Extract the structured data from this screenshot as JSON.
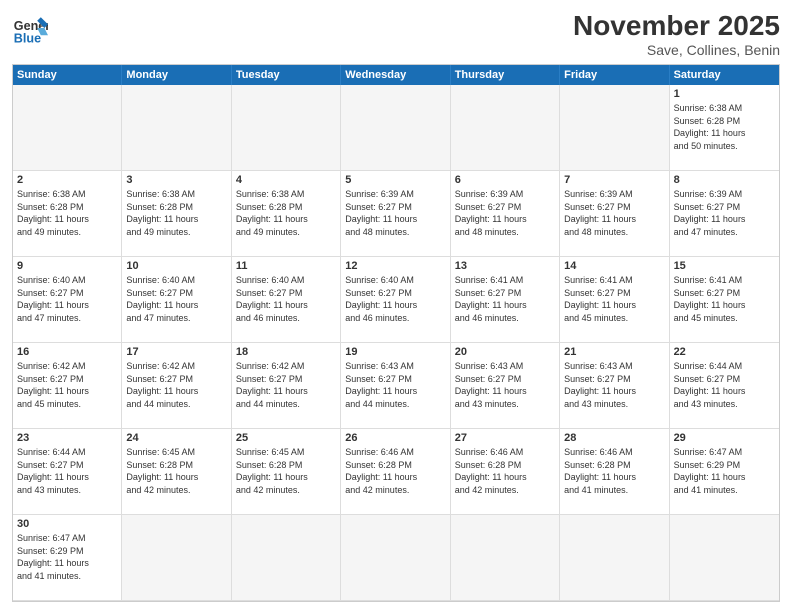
{
  "header": {
    "logo_general": "General",
    "logo_blue": "Blue",
    "month_title": "November 2025",
    "subtitle": "Save, Collines, Benin"
  },
  "weekdays": [
    "Sunday",
    "Monday",
    "Tuesday",
    "Wednesday",
    "Thursday",
    "Friday",
    "Saturday"
  ],
  "weeks": [
    [
      {
        "day": "",
        "text": ""
      },
      {
        "day": "",
        "text": ""
      },
      {
        "day": "",
        "text": ""
      },
      {
        "day": "",
        "text": ""
      },
      {
        "day": "",
        "text": ""
      },
      {
        "day": "",
        "text": ""
      },
      {
        "day": "1",
        "text": "Sunrise: 6:38 AM\nSunset: 6:28 PM\nDaylight: 11 hours\nand 50 minutes."
      }
    ],
    [
      {
        "day": "2",
        "text": "Sunrise: 6:38 AM\nSunset: 6:28 PM\nDaylight: 11 hours\nand 49 minutes."
      },
      {
        "day": "3",
        "text": "Sunrise: 6:38 AM\nSunset: 6:28 PM\nDaylight: 11 hours\nand 49 minutes."
      },
      {
        "day": "4",
        "text": "Sunrise: 6:38 AM\nSunset: 6:28 PM\nDaylight: 11 hours\nand 49 minutes."
      },
      {
        "day": "5",
        "text": "Sunrise: 6:39 AM\nSunset: 6:27 PM\nDaylight: 11 hours\nand 48 minutes."
      },
      {
        "day": "6",
        "text": "Sunrise: 6:39 AM\nSunset: 6:27 PM\nDaylight: 11 hours\nand 48 minutes."
      },
      {
        "day": "7",
        "text": "Sunrise: 6:39 AM\nSunset: 6:27 PM\nDaylight: 11 hours\nand 48 minutes."
      },
      {
        "day": "8",
        "text": "Sunrise: 6:39 AM\nSunset: 6:27 PM\nDaylight: 11 hours\nand 47 minutes."
      }
    ],
    [
      {
        "day": "9",
        "text": "Sunrise: 6:40 AM\nSunset: 6:27 PM\nDaylight: 11 hours\nand 47 minutes."
      },
      {
        "day": "10",
        "text": "Sunrise: 6:40 AM\nSunset: 6:27 PM\nDaylight: 11 hours\nand 47 minutes."
      },
      {
        "day": "11",
        "text": "Sunrise: 6:40 AM\nSunset: 6:27 PM\nDaylight: 11 hours\nand 46 minutes."
      },
      {
        "day": "12",
        "text": "Sunrise: 6:40 AM\nSunset: 6:27 PM\nDaylight: 11 hours\nand 46 minutes."
      },
      {
        "day": "13",
        "text": "Sunrise: 6:41 AM\nSunset: 6:27 PM\nDaylight: 11 hours\nand 46 minutes."
      },
      {
        "day": "14",
        "text": "Sunrise: 6:41 AM\nSunset: 6:27 PM\nDaylight: 11 hours\nand 45 minutes."
      },
      {
        "day": "15",
        "text": "Sunrise: 6:41 AM\nSunset: 6:27 PM\nDaylight: 11 hours\nand 45 minutes."
      }
    ],
    [
      {
        "day": "16",
        "text": "Sunrise: 6:42 AM\nSunset: 6:27 PM\nDaylight: 11 hours\nand 45 minutes."
      },
      {
        "day": "17",
        "text": "Sunrise: 6:42 AM\nSunset: 6:27 PM\nDaylight: 11 hours\nand 44 minutes."
      },
      {
        "day": "18",
        "text": "Sunrise: 6:42 AM\nSunset: 6:27 PM\nDaylight: 11 hours\nand 44 minutes."
      },
      {
        "day": "19",
        "text": "Sunrise: 6:43 AM\nSunset: 6:27 PM\nDaylight: 11 hours\nand 44 minutes."
      },
      {
        "day": "20",
        "text": "Sunrise: 6:43 AM\nSunset: 6:27 PM\nDaylight: 11 hours\nand 43 minutes."
      },
      {
        "day": "21",
        "text": "Sunrise: 6:43 AM\nSunset: 6:27 PM\nDaylight: 11 hours\nand 43 minutes."
      },
      {
        "day": "22",
        "text": "Sunrise: 6:44 AM\nSunset: 6:27 PM\nDaylight: 11 hours\nand 43 minutes."
      }
    ],
    [
      {
        "day": "23",
        "text": "Sunrise: 6:44 AM\nSunset: 6:27 PM\nDaylight: 11 hours\nand 43 minutes."
      },
      {
        "day": "24",
        "text": "Sunrise: 6:45 AM\nSunset: 6:28 PM\nDaylight: 11 hours\nand 42 minutes."
      },
      {
        "day": "25",
        "text": "Sunrise: 6:45 AM\nSunset: 6:28 PM\nDaylight: 11 hours\nand 42 minutes."
      },
      {
        "day": "26",
        "text": "Sunrise: 6:46 AM\nSunset: 6:28 PM\nDaylight: 11 hours\nand 42 minutes."
      },
      {
        "day": "27",
        "text": "Sunrise: 6:46 AM\nSunset: 6:28 PM\nDaylight: 11 hours\nand 42 minutes."
      },
      {
        "day": "28",
        "text": "Sunrise: 6:46 AM\nSunset: 6:28 PM\nDaylight: 11 hours\nand 41 minutes."
      },
      {
        "day": "29",
        "text": "Sunrise: 6:47 AM\nSunset: 6:29 PM\nDaylight: 11 hours\nand 41 minutes."
      }
    ],
    [
      {
        "day": "30",
        "text": "Sunrise: 6:47 AM\nSunset: 6:29 PM\nDaylight: 11 hours\nand 41 minutes."
      },
      {
        "day": "",
        "text": ""
      },
      {
        "day": "",
        "text": ""
      },
      {
        "day": "",
        "text": ""
      },
      {
        "day": "",
        "text": ""
      },
      {
        "day": "",
        "text": ""
      },
      {
        "day": "",
        "text": ""
      }
    ]
  ]
}
